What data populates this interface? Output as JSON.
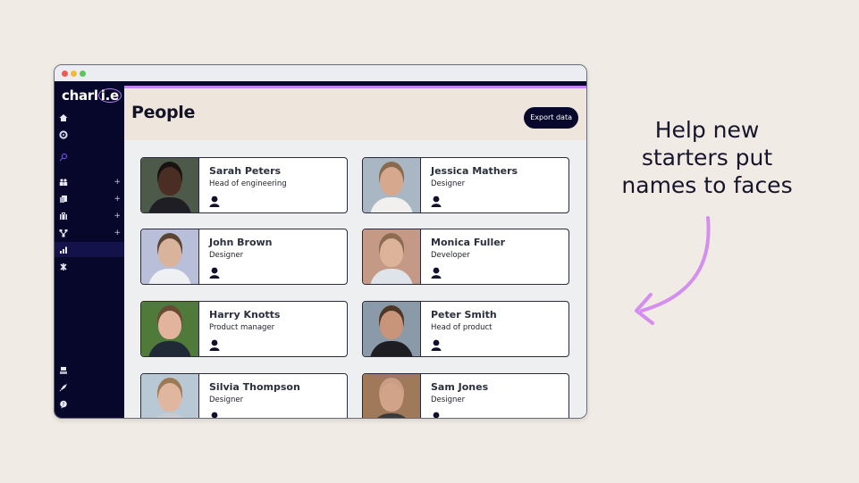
{
  "app": {
    "logo_text": "charl",
    "logo_suffix": "i.e"
  },
  "sidebar": {
    "top_items": [
      {
        "icon": "home-icon"
      },
      {
        "icon": "gear-icon"
      },
      {
        "icon": "search-icon"
      }
    ],
    "items": [
      {
        "icon": "people-icon",
        "expandable": true
      },
      {
        "icon": "documents-icon",
        "expandable": true
      },
      {
        "icon": "briefcase-icon",
        "expandable": true
      },
      {
        "icon": "org-chart-icon",
        "expandable": true
      },
      {
        "icon": "bar-chart-icon",
        "expandable": false,
        "active": true
      },
      {
        "icon": "puzzle-icon",
        "expandable": false
      }
    ],
    "bottom_items": [
      {
        "icon": "database-icon"
      },
      {
        "icon": "rocket-icon"
      },
      {
        "icon": "help-icon"
      }
    ],
    "plus_label": "+"
  },
  "header": {
    "title": "People",
    "export_label": "Export data"
  },
  "people": [
    {
      "name": "Sarah Peters",
      "role": "Head of engineering",
      "skin": "#4a2e24",
      "hair": "#1a1210",
      "shirt": "#1e1e24",
      "bg": "#4d5a4a"
    },
    {
      "name": "Jessica Mathers",
      "role": "Designer",
      "skin": "#d6a98f",
      "hair": "#8a6a4e",
      "shirt": "#f2f0ee",
      "bg": "#a9b7c4"
    },
    {
      "name": "John Brown",
      "role": "Designer",
      "skin": "#d9b39c",
      "hair": "#5a4434",
      "shirt": "#eef0f4",
      "bg": "#b9bfd9"
    },
    {
      "name": "Monica Fuller",
      "role": "Developer",
      "skin": "#ddb39a",
      "hair": "#8a6c52",
      "shirt": "#dfe3ea",
      "bg": "#c49a86"
    },
    {
      "name": "Harry Knotts",
      "role": "Product manager",
      "skin": "#e2b49e",
      "hair": "#6a4a32",
      "shirt": "#1f2a36",
      "bg": "#4f7a3a"
    },
    {
      "name": "Peter Smith",
      "role": "Head of product",
      "skin": "#c9957a",
      "hair": "#4c3626",
      "shirt": "#1e1e22",
      "bg": "#8a9aa8"
    },
    {
      "name": "Silvia Thompson",
      "role": "Designer",
      "skin": "#e0b79e",
      "hair": "#9c7a58",
      "shirt": "#c8ccd2",
      "bg": "#b8c8d4"
    },
    {
      "name": "Sam Jones",
      "role": "Designer",
      "skin": "#d1a48a",
      "hair": "#c99e84",
      "shirt": "#3a3a3a",
      "bg": "#a0785a"
    }
  ],
  "tagline": {
    "lines": [
      "Help new",
      "starters put",
      "names to faces"
    ]
  },
  "colors": {
    "accent": "#c486ec",
    "sidebar_bg": "#07062b",
    "page_bg": "#f1ebe5"
  }
}
